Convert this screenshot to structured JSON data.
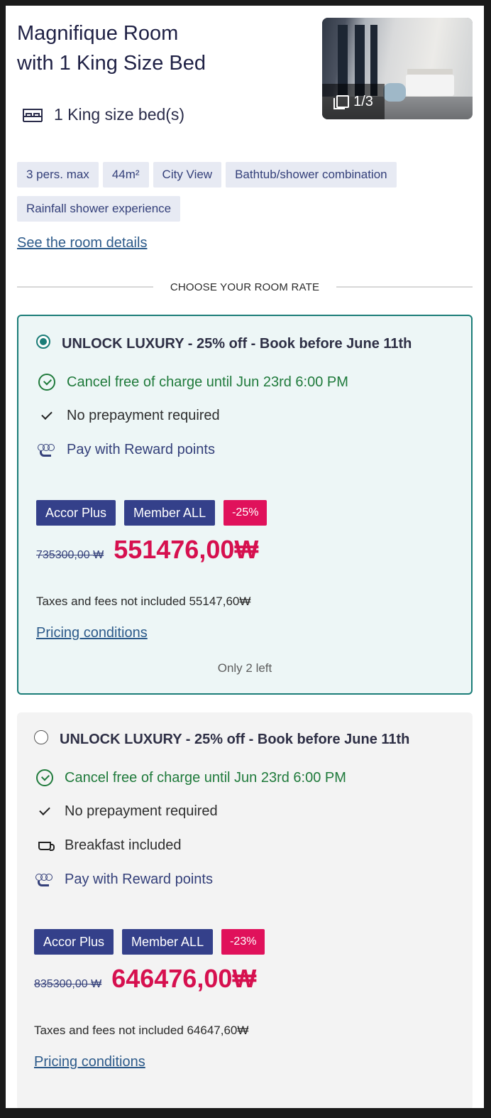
{
  "room": {
    "title_line1": "Magnifique Room",
    "title_line2": "with 1 King Size Bed",
    "photo_counter": "1/3",
    "bed": "1 King size bed(s)",
    "tags": [
      "3 pers. max",
      "44m²",
      "City View",
      "Bathtub/shower combination",
      "Rainfall shower experience"
    ],
    "details_link": "See the room details"
  },
  "section_heading": "CHOOSE YOUR ROOM RATE",
  "rates": [
    {
      "selected": true,
      "title": "UNLOCK LUXURY - 25% off - Book before June 11th",
      "cancel": "Cancel free of charge until Jun 23rd 6:00 PM",
      "prepay": "No prepayment required",
      "rewards": "Pay with Reward points",
      "badge1": "Accor Plus",
      "badge2": "Member ALL",
      "discount": "-25%",
      "old_price": "735300,00 ₩",
      "new_price": "551476,00₩",
      "taxes": "Taxes and fees not included 55147,60₩",
      "pricing_link": "Pricing conditions",
      "availability": "Only 2 left"
    },
    {
      "selected": false,
      "title": "UNLOCK LUXURY - 25% off - Book before June 11th",
      "cancel": "Cancel free of charge until Jun 23rd 6:00 PM",
      "prepay": "No prepayment required",
      "breakfast": "Breakfast included",
      "rewards": "Pay with Reward points",
      "badge1": "Accor Plus",
      "badge2": "Member ALL",
      "discount": "-23%",
      "old_price": "835300,00 ₩",
      "new_price": "646476,00₩",
      "taxes": "Taxes and fees not included 64647,60₩",
      "pricing_link": "Pricing conditions"
    }
  ],
  "colors": {
    "accent_teal": "#1b7d78",
    "price_red": "#d6104f",
    "badge_navy": "#34408a",
    "cancel_green": "#1f7a3b"
  }
}
